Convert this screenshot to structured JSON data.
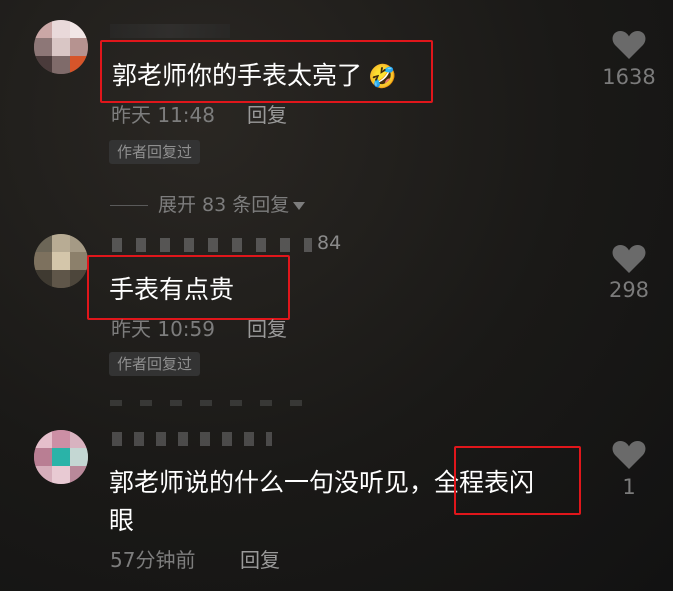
{
  "comments": [
    {
      "text": "郭老师你的手表太亮了",
      "emoji": "🤣",
      "time": "昨天 11:48",
      "reply": "回复",
      "badge": "作者回复过",
      "likes": "1638",
      "expand": "展开 83 条回复"
    },
    {
      "username_fragment": "84",
      "text": "手表有点贵",
      "time": "昨天 10:59",
      "reply": "回复",
      "badge": "作者回复过",
      "likes": "298"
    },
    {
      "text_line1": "郭老师说的什么一句没听见，",
      "text_highlight": "全程表闪",
      "text_line2": "眼",
      "time": "57分钟前",
      "reply": "回复",
      "likes": "1"
    }
  ],
  "colors": {
    "highlight_box": "#e0161b",
    "background": "#1a1917",
    "meta_text": "#7d7d7d"
  },
  "icons": [
    "heart-icon",
    "chevron-down-icon"
  ]
}
